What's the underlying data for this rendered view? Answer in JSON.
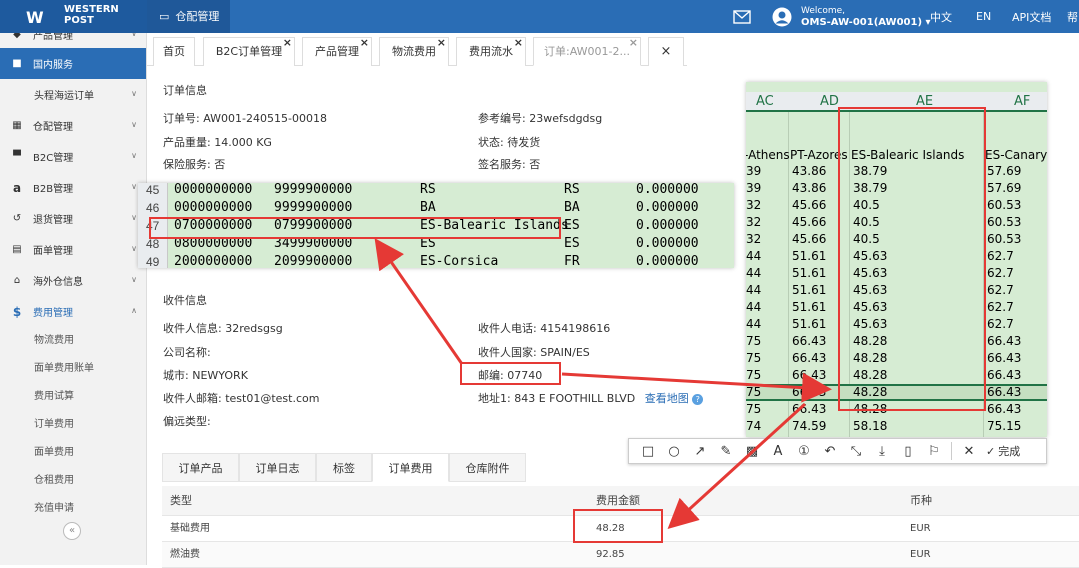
{
  "brand": {
    "line1": "WESTERN",
    "line2": "POST"
  },
  "top_menu": {
    "label": "仓配管理"
  },
  "header": {
    "welcome": "Welcome,",
    "user": "OMS-AW-001(AW001)",
    "lang_cn": "中文",
    "lang_en": "EN",
    "api_doc": "API文档",
    "help": "帮"
  },
  "sidebar": {
    "items": [
      {
        "label": "产品管理",
        "icon": "tag-icon"
      },
      {
        "label": "国内服务",
        "icon": "folder-icon"
      },
      {
        "label": "头程海运订单",
        "icon": ""
      },
      {
        "label": "仓配管理",
        "icon": "grid-icon"
      },
      {
        "label": "B2C管理",
        "icon": "cart-icon"
      },
      {
        "label": "B2B管理",
        "icon": "amazon-icon"
      },
      {
        "label": "退货管理",
        "icon": "return-icon"
      },
      {
        "label": "面单管理",
        "icon": "label-icon"
      },
      {
        "label": "海外仓信息",
        "icon": "home-icon"
      },
      {
        "label": "费用管理",
        "icon": "dollar-icon"
      }
    ],
    "sub_items": [
      "物流费用",
      "面单费用账单",
      "费用试算",
      "订单费用",
      "面单费用",
      "仓租费用",
      "充值申请"
    ]
  },
  "tabs": [
    "首页",
    "B2C订单管理",
    "产品管理",
    "物流费用",
    "费用流水",
    "订单:AW001-2..."
  ],
  "order_info": {
    "title": "订单信息",
    "order_no_label": "订单号:",
    "order_no": "AW001-240515-00018",
    "ref_label": "参考编号:",
    "ref": "23wefsdgdsg",
    "weight_label": "产品重量:",
    "weight": "14.000 KG",
    "status_label": "状态:",
    "status": "待发货",
    "insurance_label": "保险服务:",
    "insurance": "否",
    "sign_label": "签名服务:",
    "sign": "否"
  },
  "receiver": {
    "title": "收件信息",
    "name_label": "收件人信息:",
    "name": "32redsgsg",
    "phone_label": "收件人电话:",
    "phone": "4154198616",
    "company_label": "公司名称:",
    "company": "",
    "country_label": "收件人国家:",
    "country": "SPAIN/ES",
    "city_label": "城市:",
    "city": "NEWYORK",
    "zip_label": "邮编:",
    "zip": "07740",
    "email_label": "收件人邮箱:",
    "email": "test01@test.com",
    "address_label": "地址1:",
    "address": "843 E FOOTHILL BLVD",
    "map_link": "查看地图",
    "remote_label": "偏远类型:"
  },
  "sheet_rows": [
    {
      "num": "45",
      "a": "0000000000",
      "b": "9999900000",
      "c": "RS",
      "d": "RS",
      "e": "0.000000"
    },
    {
      "num": "46",
      "a": "0000000000",
      "b": "9999900000",
      "c": "BA",
      "d": "BA",
      "e": "0.000000"
    },
    {
      "num": "47",
      "a": "0700000000",
      "b": "0799900000",
      "c": "ES-Balearic Islands",
      "d": "ES",
      "e": "0.000000"
    },
    {
      "num": "48",
      "a": "0800000000",
      "b": "3499900000",
      "c": "ES",
      "d": "ES",
      "e": "0.000000"
    },
    {
      "num": "49",
      "a": "2000000000",
      "b": "2099900000",
      "c": "ES-Corsica",
      "d": "FR",
      "e": "0.000000"
    }
  ],
  "rate_sheet": {
    "columns": [
      "AC",
      "AD",
      "AE",
      "AF"
    ],
    "headers": [
      "-Athens",
      "PT-Azores",
      "ES-Balearic Islands",
      "ES-Canary"
    ],
    "rows": [
      [
        "39",
        "43.86",
        "38.79",
        "57.69"
      ],
      [
        "39",
        "43.86",
        "38.79",
        "57.69"
      ],
      [
        "32",
        "45.66",
        "40.5",
        "60.53"
      ],
      [
        "32",
        "45.66",
        "40.5",
        "60.53"
      ],
      [
        "32",
        "45.66",
        "40.5",
        "60.53"
      ],
      [
        "44",
        "51.61",
        "45.63",
        "62.7"
      ],
      [
        "44",
        "51.61",
        "45.63",
        "62.7"
      ],
      [
        "44",
        "51.61",
        "45.63",
        "62.7"
      ],
      [
        "44",
        "51.61",
        "45.63",
        "62.7"
      ],
      [
        "44",
        "51.61",
        "45.63",
        "62.7"
      ],
      [
        "75",
        "66.43",
        "48.28",
        "66.43"
      ],
      [
        "75",
        "66.43",
        "48.28",
        "66.43"
      ],
      [
        "75",
        "66.43",
        "48.28",
        "66.43"
      ],
      [
        "75",
        "66.43",
        "48.28",
        "66.43"
      ],
      [
        "75",
        "66.43",
        "48.28",
        "66.43"
      ],
      [
        "74",
        "74.59",
        "58.18",
        "75.15"
      ]
    ]
  },
  "toolbar": {
    "done": "完成"
  },
  "sub_tabs": [
    "订单产品",
    "订单日志",
    "标签",
    "订单费用",
    "仓库附件"
  ],
  "fee_table": {
    "headers": [
      "类型",
      "费用金额",
      "币种"
    ],
    "rows": [
      [
        "基础费用",
        "48.28",
        "EUR"
      ],
      [
        "燃油费",
        "92.85",
        "EUR"
      ]
    ]
  },
  "colors": {
    "primary": "#2a6db5",
    "annotation": "#e53935",
    "sheet_bg": "#d6ecd3"
  }
}
